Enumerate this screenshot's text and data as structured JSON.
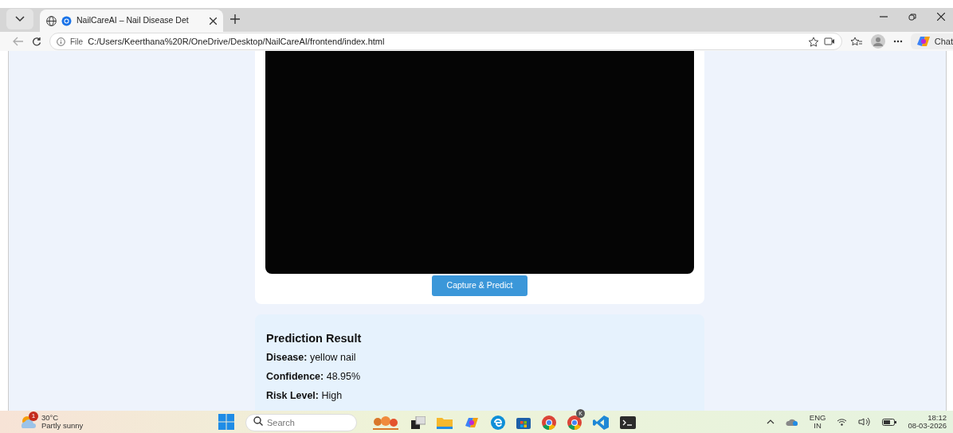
{
  "browser": {
    "tab": {
      "title": "NailCareAI – Nail Disease Det",
      "selected": true
    },
    "address": {
      "scheme": "File",
      "url": "C:/Users/Keerthana%20R/OneDrive/Desktop/NailCareAI/frontend/index.html"
    },
    "chat_label": "Chat"
  },
  "page": {
    "capture_button": "Capture & Predict",
    "result": {
      "title": "Prediction Result",
      "lines": [
        "**Disease:** yellow nail",
        "**Confidence:** 48.95%",
        "**Risk Level:** High"
      ]
    }
  },
  "taskbar": {
    "weather": {
      "temperature": "30°C",
      "condition": "Partly sunny",
      "badge": "1"
    },
    "search": {
      "placeholder": "Search"
    },
    "apps": [
      {
        "kind": "widgets"
      },
      {
        "kind": "taskview"
      },
      {
        "kind": "files"
      },
      {
        "kind": "copilot"
      },
      {
        "kind": "edge"
      },
      {
        "kind": "store"
      },
      {
        "kind": "chrome"
      },
      {
        "kind": "chrome",
        "badge": "K"
      },
      {
        "kind": "vscode"
      },
      {
        "kind": "terminal"
      }
    ],
    "tray": {
      "language": "ENG",
      "region": "IN",
      "time": "18:12",
      "date": "08-03-2026"
    }
  }
}
